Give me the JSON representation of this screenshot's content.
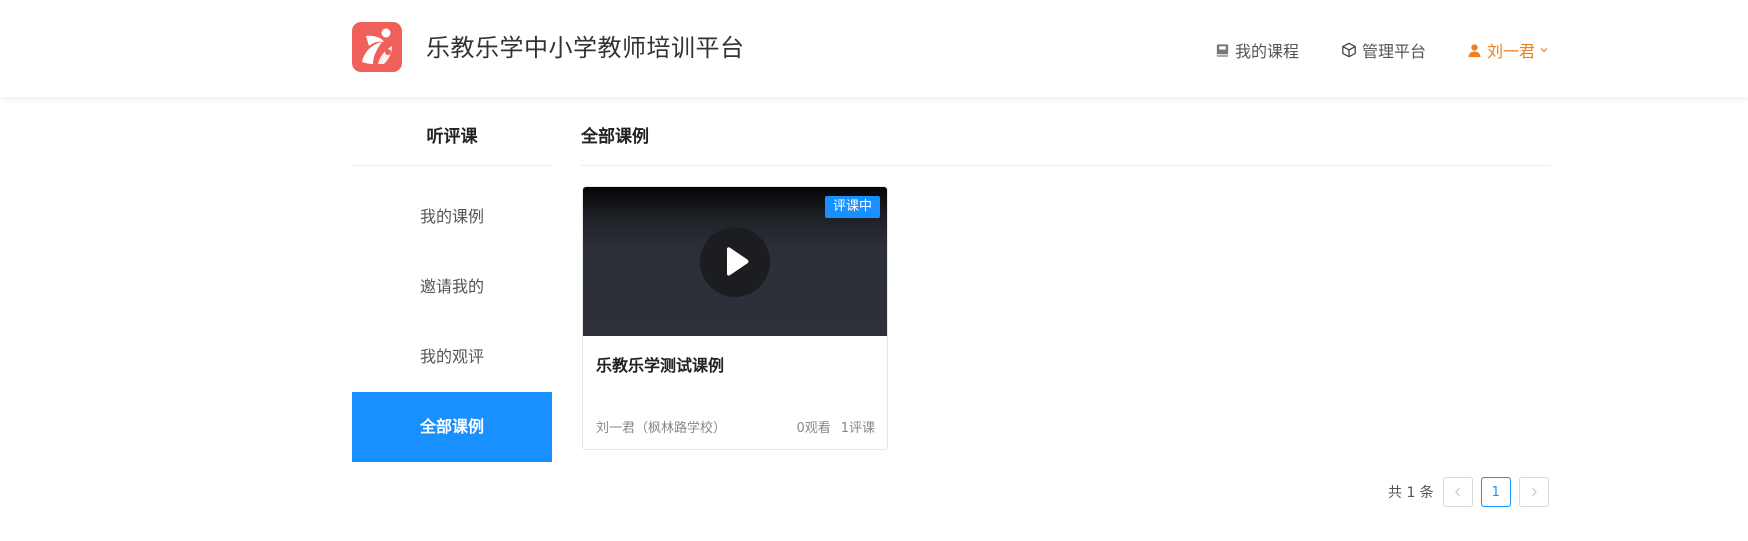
{
  "header": {
    "site_title": "乐教乐学中小学教师培训平台",
    "nav": {
      "my_courses": "我的课程",
      "admin_platform": "管理平台",
      "user_name": "刘一君"
    }
  },
  "sidebar": {
    "title": "听评课",
    "items": [
      {
        "label": "我的课例",
        "active": false
      },
      {
        "label": "邀请我的",
        "active": false
      },
      {
        "label": "我的观评",
        "active": false
      },
      {
        "label": "全部课例",
        "active": true
      }
    ]
  },
  "content": {
    "title": "全部课例",
    "cards": [
      {
        "badge": "评课中",
        "title": "乐教乐学测试课例",
        "author": "刘一君（枫林路学校）",
        "views": "0观看",
        "reviews": "1评课"
      }
    ]
  },
  "pagination": {
    "total_text": "共 1 条",
    "current_page": "1"
  },
  "colors": {
    "accent": "#1890ff",
    "user": "#f07f1e",
    "logo": "#f0605a"
  },
  "icons": {
    "logo": "app-logo",
    "courses": "book-icon",
    "admin": "cube-icon",
    "user": "user-icon",
    "dropdown": "chevron-down-icon",
    "play": "play-icon",
    "prev": "chevron-left-icon",
    "next": "chevron-right-icon"
  }
}
